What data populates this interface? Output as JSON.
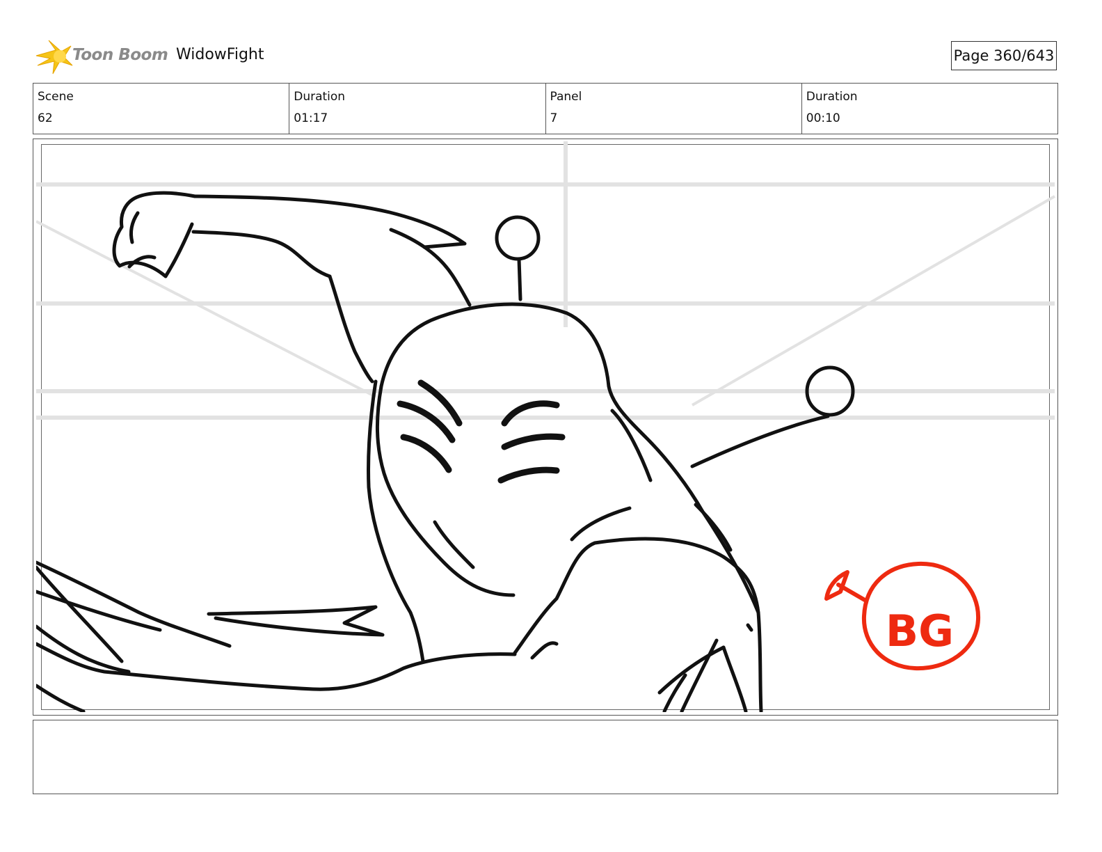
{
  "header": {
    "logo_text": "Toon Boom",
    "project_title": "WidowFight",
    "page_label": "Page 360/643"
  },
  "info": {
    "scene_label": "Scene",
    "scene_value": "62",
    "scene_duration_label": "Duration",
    "scene_duration_value": "01:17",
    "panel_label": "Panel",
    "panel_value": "7",
    "panel_duration_label": "Duration",
    "panel_duration_value": "00:10"
  },
  "sketch": {
    "annotation_text": "BG",
    "annotation_color": "#ee2a10",
    "line_color": "#111111",
    "guide_color": "#e2e2e2"
  },
  "colors": {
    "logo_flame": "#f5c518",
    "logo_text": "#8a8a8a"
  }
}
